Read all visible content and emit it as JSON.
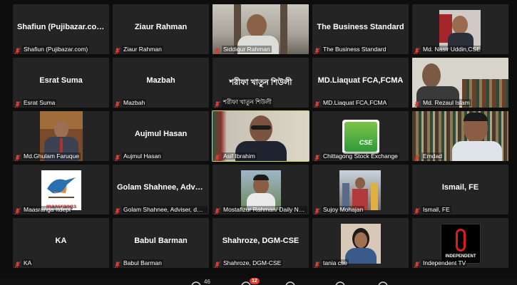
{
  "meeting": {
    "participant_count": "46",
    "chat_badge": "12"
  },
  "tiles": [
    {
      "title": "Shafiun  (Pujibazar.com)",
      "name": "Shafiun (Pujibazar.com)",
      "type": "text"
    },
    {
      "title": "Ziaur Rahman",
      "name": "Ziaur Rahman",
      "type": "text"
    },
    {
      "title": "",
      "name": "Siddiqur Rahman",
      "type": "video",
      "scene": "man-office"
    },
    {
      "title": "The Business Standard",
      "name": "The Business Standard",
      "type": "text"
    },
    {
      "title": "",
      "name": "Md. Nasir Uddin,CSE",
      "type": "photo",
      "scene": "portrait-red"
    },
    {
      "title": "Esrat Suma",
      "name": "Esrat Suma",
      "type": "text"
    },
    {
      "title": "Mazbah",
      "name": "Mazbah",
      "type": "text"
    },
    {
      "title": "শরীফা খাতুন শিউলী",
      "name": "শরীফা খাতুন শিউলী",
      "type": "text"
    },
    {
      "title": "MD.Liaquat FCA,FCMA",
      "name": "MD.Liaquat FCA,FCMA",
      "type": "text"
    },
    {
      "title": "",
      "name": "Md. Rezaul Islam",
      "type": "video",
      "scene": "man-shelves"
    },
    {
      "title": "",
      "name": "Md.Ghulam Faruque",
      "type": "video",
      "scene": "man-suit"
    },
    {
      "title": "Aujmul Hasan",
      "name": "Aujmul Hasan",
      "type": "text"
    },
    {
      "title": "",
      "name": "Asif Ibrahim",
      "type": "video",
      "scene": "speaker",
      "active": true
    },
    {
      "title": "",
      "name": "Chittagong Stock Exchange",
      "type": "logo",
      "logo_text": "CSE"
    },
    {
      "title": "",
      "name": "Emdad",
      "type": "video",
      "scene": "man-bookshelf"
    },
    {
      "title": "",
      "name": "Maasranga Itdept",
      "type": "logo",
      "logo_text": "maasranga"
    },
    {
      "title": "Golam Shahnee, Adviser, dhaka",
      "name": "Golam Shahnee, Adviser, dhakt",
      "type": "text"
    },
    {
      "title": "",
      "name": "Mostafizur Rahman/ Daily New Age",
      "type": "photo",
      "scene": "portrait-outdoor"
    },
    {
      "title": "",
      "name": "Sujoy Mohajan",
      "type": "photo",
      "scene": "group"
    },
    {
      "title": "Ismail, FE",
      "name": "Ismail, FE",
      "type": "text"
    },
    {
      "title": "KA",
      "name": "KA",
      "type": "text"
    },
    {
      "title": "Babul Barman",
      "name": "Babul Barman",
      "type": "text"
    },
    {
      "title": "Shahroze, DGM-CSE",
      "name": "Shahroze, DGM-CSE",
      "type": "text"
    },
    {
      "title": "",
      "name": "tania cse",
      "type": "photo",
      "scene": "woman"
    },
    {
      "title": "",
      "name": "Independent TV",
      "type": "logo",
      "logo_text": "INDEPENDENT"
    }
  ],
  "colors": {
    "tile_bg": "#242424",
    "page_bg": "#0d0d0d",
    "mic_muted": "#e03a2f",
    "active_border": "#c8d94a"
  }
}
